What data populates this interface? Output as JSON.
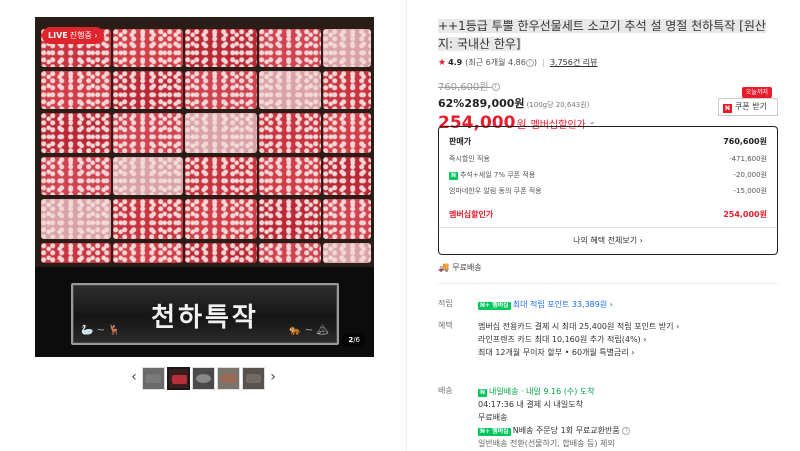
{
  "gallery": {
    "live_badge": "LIVE",
    "live_badge_sub": "진행중 ›",
    "plaque_title": "천하특작",
    "page_current": "2",
    "page_total": "/6",
    "thumbnail_count": 5
  },
  "product": {
    "title": "++1등급 투뿔 한우선물세트 소고기 추석 설 명절 천하특작 [원산지: 국내산 한우]",
    "rating": "4.9",
    "rating_note": "(최근 6개월 4.86",
    "rating_note_close": ")",
    "review_count": "3,756건 리뷰",
    "original_price": "760,600원",
    "discount_line": "62%289,000원",
    "unit_price": "(100g당 20,643원)",
    "final_price": "254,000",
    "final_won": "원",
    "final_label": "멤버십할인가",
    "coupon_tag": "오늘까지",
    "coupon_label": "쿠폰 받기",
    "coupon_n": "N"
  },
  "price_box": {
    "rows": [
      {
        "label": "판매가",
        "value": "760,600원"
      },
      {
        "label": "즉시할인 적용",
        "value": "-471,600원"
      },
      {
        "label": "추석+세일 7% 쿠폰 적용",
        "value": "-20,000원",
        "badge": "N"
      },
      {
        "label": "엄마네한우 알림 동의 쿠폰 적용",
        "value": "-15,000원"
      }
    ],
    "total_label": "멤버십할인가",
    "total_value": "254,000원",
    "benefit_link": "나의 혜택 전체보기 ›"
  },
  "shipping_free": "무료배송",
  "points": {
    "label": "적립",
    "badge": "N+ 멤버십",
    "text": "최대 적립 포인트 33,389원 ›"
  },
  "benefits": {
    "label": "혜택",
    "lines": [
      "멤버십 전용카드 결제 시 최대 25,400원 적립 포인트 받기 ›",
      "라인프렌즈 카드 최대 10,160원 추가 적립(4%) ›",
      "최대 12개월 무이자 할부 • 60개월 특별금리 ›"
    ]
  },
  "delivery": {
    "label": "배송",
    "arrival": "내일배송 · 내일 9.16 (수) 도착",
    "cutoff": "04:17:36  내 결제 시 내일도착",
    "free": "무료배송",
    "return": "N배송 주문당 1회 무료교환반품",
    "exception": "일반배송 전환(선물하기, 합배송 등) 제외",
    "badge": "N+ 멤버십"
  },
  "colors": {
    "accent_red": "#e81d2c",
    "naver_green": "#03c75a",
    "link_blue": "#1d6ff2"
  }
}
